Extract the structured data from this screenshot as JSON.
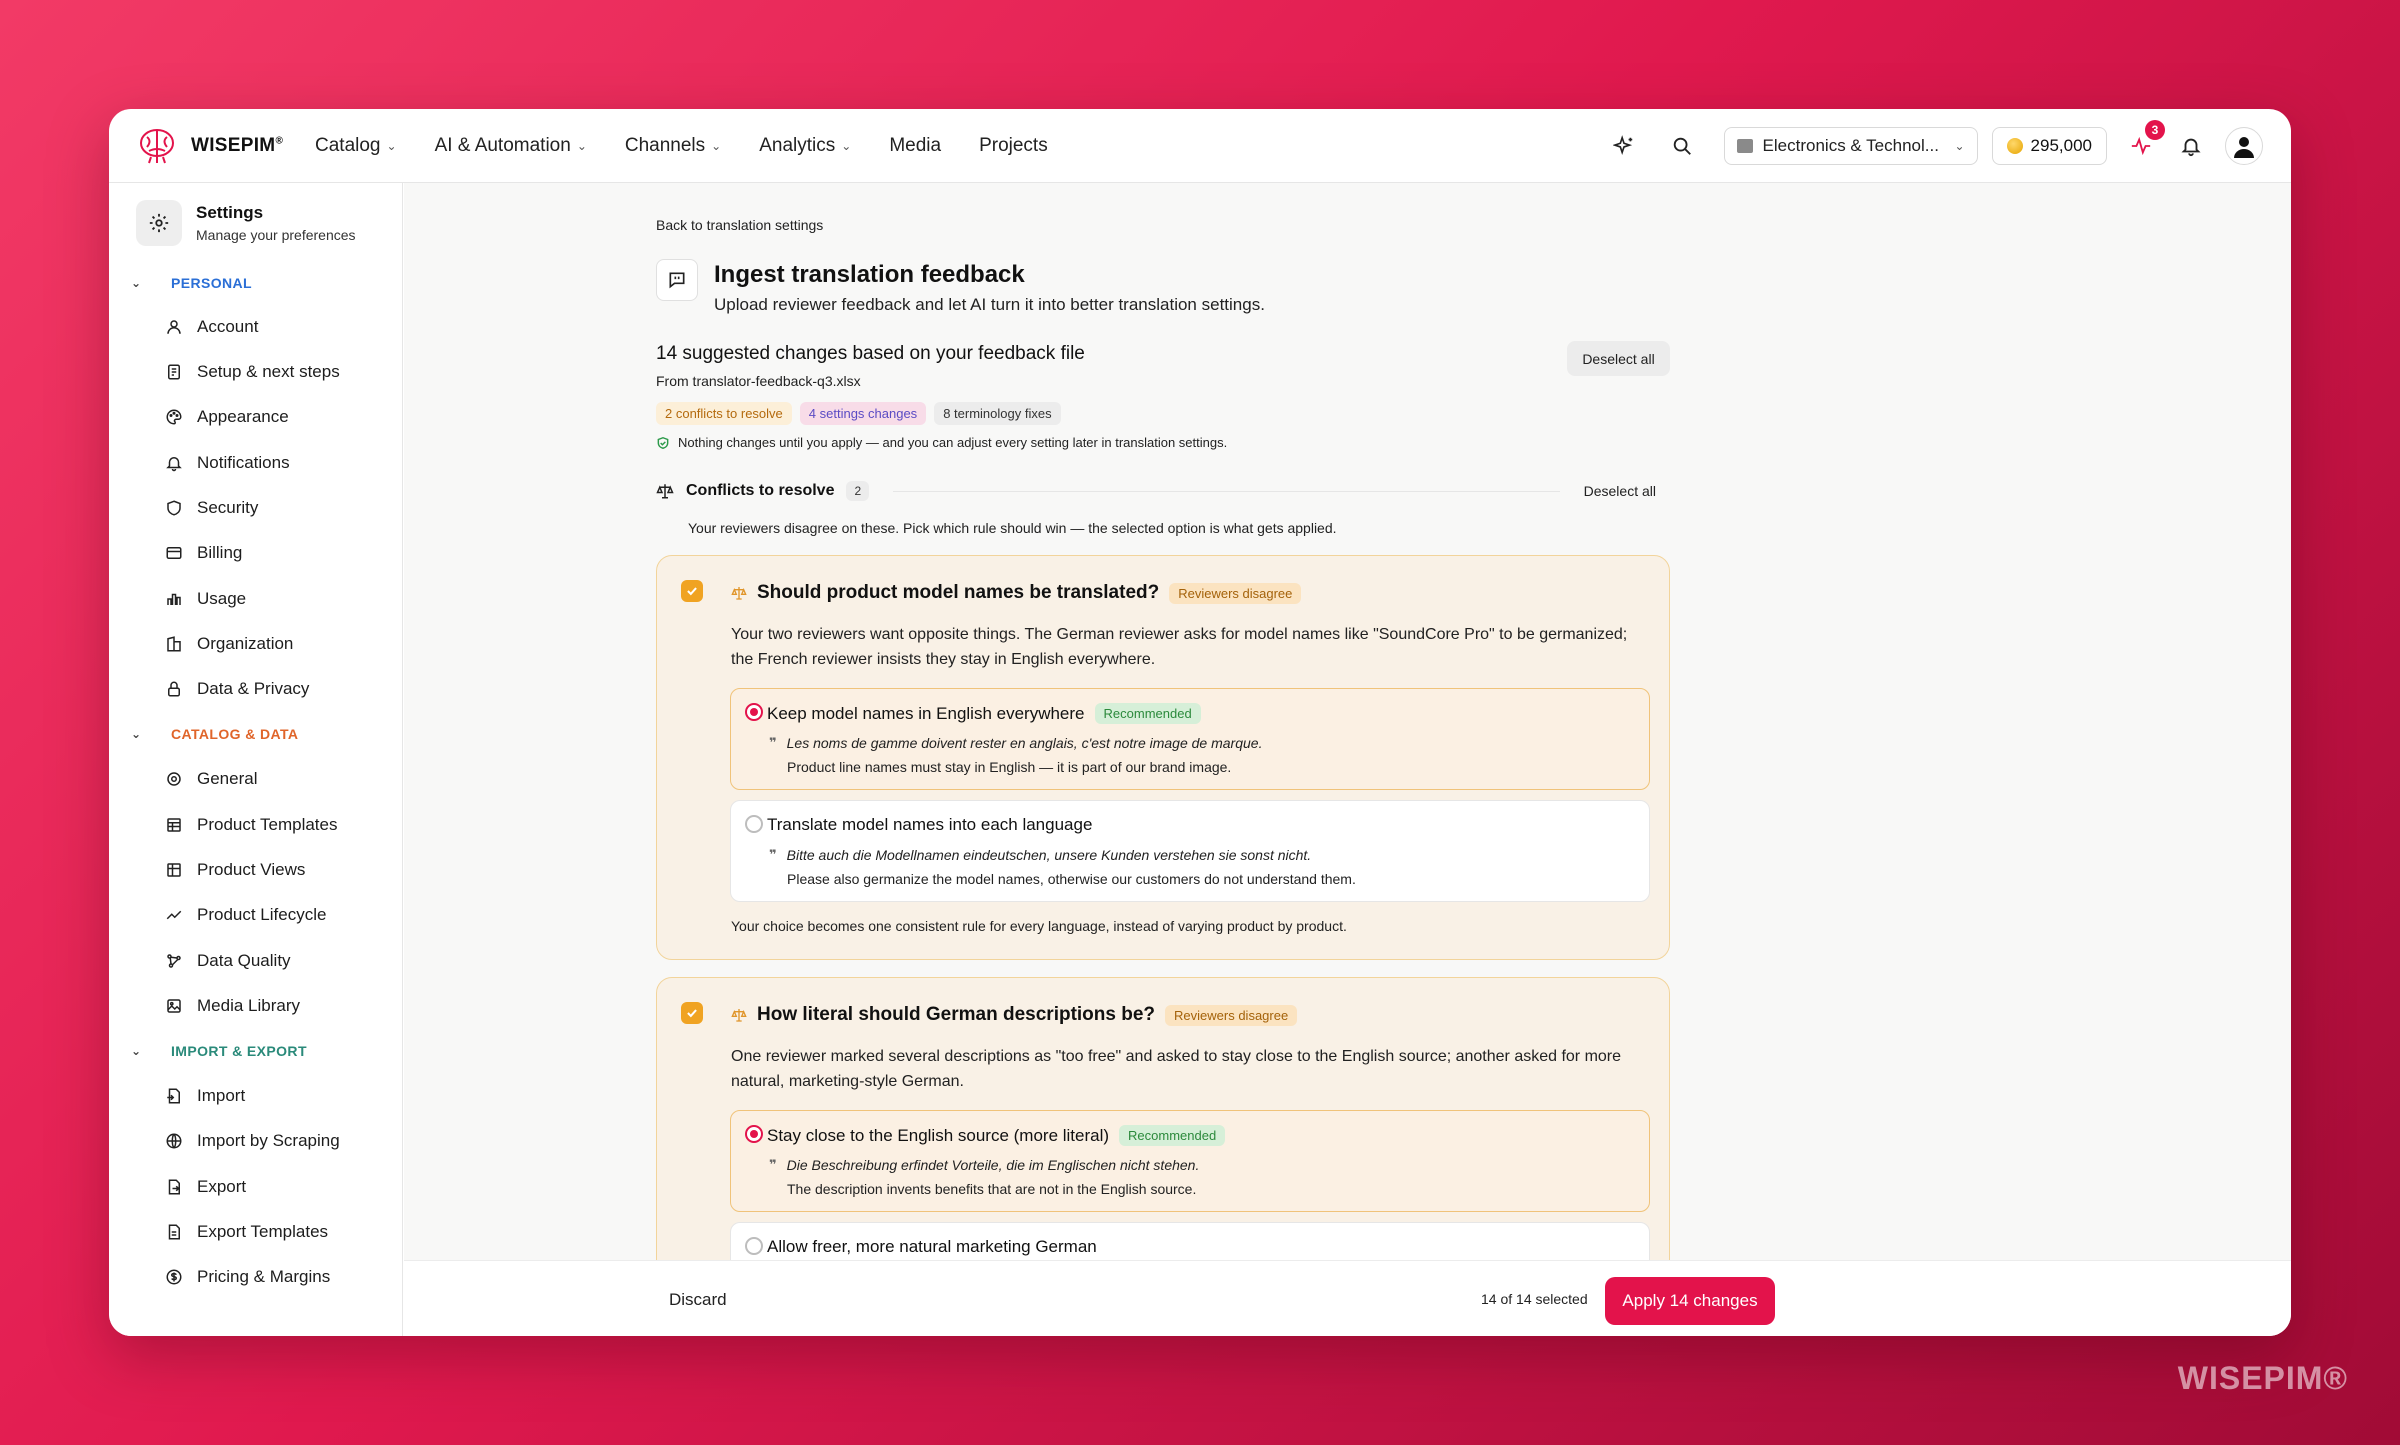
{
  "brand": {
    "name": "WISEPIM",
    "mark": "®",
    "watermark": "WISEPIM®"
  },
  "nav": {
    "items": [
      {
        "label": "Catalog",
        "dropdown": true
      },
      {
        "label": "AI & Automation",
        "dropdown": true
      },
      {
        "label": "Channels",
        "dropdown": true
      },
      {
        "label": "Analytics",
        "dropdown": true
      },
      {
        "label": "Media",
        "dropdown": false
      },
      {
        "label": "Projects",
        "dropdown": false
      }
    ],
    "channel": "Electronics & Technol...",
    "credits": "295,000",
    "activity_badge": "3"
  },
  "sidebar": {
    "title": "Settings",
    "subtitle": "Manage your preferences",
    "sections": [
      {
        "label": "PERSONAL",
        "color": "#2b6fd6"
      },
      {
        "label": "CATALOG & DATA",
        "color": "#e0652a"
      },
      {
        "label": "IMPORT & EXPORT",
        "color": "#2a8a7a"
      }
    ],
    "personal_items": [
      "Account",
      "Setup & next steps",
      "Appearance",
      "Notifications",
      "Security",
      "Billing",
      "Usage",
      "Organization",
      "Data & Privacy"
    ],
    "catalog_items": [
      "General",
      "Product Templates",
      "Product Views",
      "Product Lifecycle",
      "Data Quality",
      "Media Library"
    ],
    "import_items": [
      "Import",
      "Import by Scraping",
      "Export",
      "Export Templates",
      "Pricing & Margins"
    ]
  },
  "page": {
    "back": "Back to translation settings",
    "title": "Ingest translation feedback",
    "subtitle": "Upload reviewer feedback and let AI turn it into better translation settings.",
    "summary_title": "14 suggested changes based on your feedback file",
    "summary_file": "From translator-feedback-q3.xlsx",
    "deselect_all": "Deselect all",
    "pills": [
      "2 conflicts to resolve",
      "4 settings changes",
      "8 terminology fixes"
    ],
    "note": "Nothing changes until you apply — and you can adjust every setting later in translation settings."
  },
  "conflicts": {
    "title": "Conflicts to resolve",
    "count": "2",
    "deselect": "Deselect all",
    "description": "Your reviewers disagree on these. Pick which rule should win — the selected option is what gets applied.",
    "tag": "Reviewers disagree",
    "recommended": "Recommended",
    "cards": [
      {
        "question": "Should product model names be translated?",
        "description": "Your two reviewers want opposite things. The German reviewer asks for model names like \"SoundCore Pro\" to be germanized; the French reviewer insists they stay in English everywhere.",
        "options": [
          {
            "label": "Keep model names in English everywhere",
            "quote": "Les noms de gamme doivent rester en anglais, c'est notre image de marque.",
            "translation": "Product line names must stay in English — it is part of our brand image."
          },
          {
            "label": "Translate model names into each language",
            "quote": "Bitte auch die Modellnamen eindeutschen, unsere Kunden verstehen sie sonst nicht.",
            "translation": "Please also germanize the model names, otherwise our customers do not understand them."
          }
        ],
        "footer": "Your choice becomes one consistent rule for every language, instead of varying product by product."
      },
      {
        "question": "How literal should German descriptions be?",
        "description": "One reviewer marked several descriptions as \"too free\" and asked to stay close to the English source; another asked for more natural, marketing-style German.",
        "options": [
          {
            "label": "Stay close to the English source (more literal)",
            "quote": "Die Beschreibung erfindet Vorteile, die im Englischen nicht stehen.",
            "translation": "The description invents benefits that are not in the English source."
          },
          {
            "label": "Allow freer, more natural marketing German"
          }
        ]
      }
    ]
  },
  "bottom": {
    "discard": "Discard",
    "selected": "14 of 14 selected",
    "apply": "Apply 14 changes"
  }
}
